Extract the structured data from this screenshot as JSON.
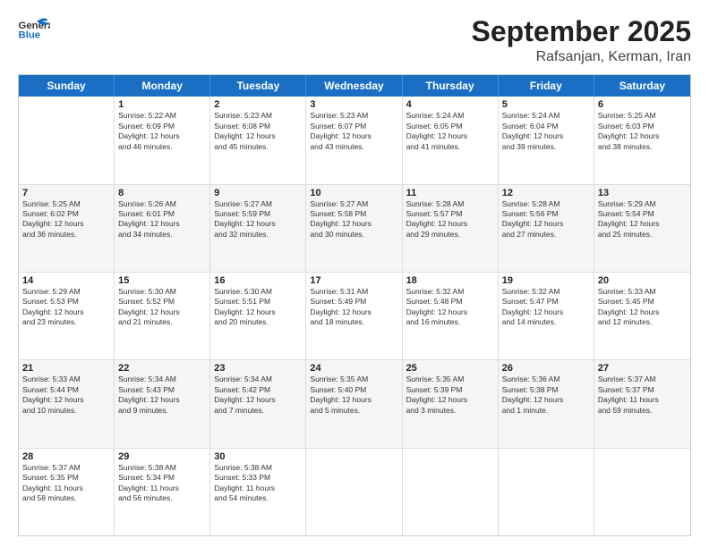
{
  "header": {
    "logo_line1": "General",
    "logo_line2": "Blue",
    "month": "September 2025",
    "location": "Rafsanjan, Kerman, Iran"
  },
  "days_of_week": [
    "Sunday",
    "Monday",
    "Tuesday",
    "Wednesday",
    "Thursday",
    "Friday",
    "Saturday"
  ],
  "rows": [
    [
      {
        "day": "",
        "lines": []
      },
      {
        "day": "1",
        "lines": [
          "Sunrise: 5:22 AM",
          "Sunset: 6:09 PM",
          "Daylight: 12 hours",
          "and 46 minutes."
        ]
      },
      {
        "day": "2",
        "lines": [
          "Sunrise: 5:23 AM",
          "Sunset: 6:08 PM",
          "Daylight: 12 hours",
          "and 45 minutes."
        ]
      },
      {
        "day": "3",
        "lines": [
          "Sunrise: 5:23 AM",
          "Sunset: 6:07 PM",
          "Daylight: 12 hours",
          "and 43 minutes."
        ]
      },
      {
        "day": "4",
        "lines": [
          "Sunrise: 5:24 AM",
          "Sunset: 6:05 PM",
          "Daylight: 12 hours",
          "and 41 minutes."
        ]
      },
      {
        "day": "5",
        "lines": [
          "Sunrise: 5:24 AM",
          "Sunset: 6:04 PM",
          "Daylight: 12 hours",
          "and 39 minutes."
        ]
      },
      {
        "day": "6",
        "lines": [
          "Sunrise: 5:25 AM",
          "Sunset: 6:03 PM",
          "Daylight: 12 hours",
          "and 38 minutes."
        ]
      }
    ],
    [
      {
        "day": "7",
        "lines": [
          "Sunrise: 5:25 AM",
          "Sunset: 6:02 PM",
          "Daylight: 12 hours",
          "and 36 minutes."
        ]
      },
      {
        "day": "8",
        "lines": [
          "Sunrise: 5:26 AM",
          "Sunset: 6:01 PM",
          "Daylight: 12 hours",
          "and 34 minutes."
        ]
      },
      {
        "day": "9",
        "lines": [
          "Sunrise: 5:27 AM",
          "Sunset: 5:59 PM",
          "Daylight: 12 hours",
          "and 32 minutes."
        ]
      },
      {
        "day": "10",
        "lines": [
          "Sunrise: 5:27 AM",
          "Sunset: 5:58 PM",
          "Daylight: 12 hours",
          "and 30 minutes."
        ]
      },
      {
        "day": "11",
        "lines": [
          "Sunrise: 5:28 AM",
          "Sunset: 5:57 PM",
          "Daylight: 12 hours",
          "and 29 minutes."
        ]
      },
      {
        "day": "12",
        "lines": [
          "Sunrise: 5:28 AM",
          "Sunset: 5:56 PM",
          "Daylight: 12 hours",
          "and 27 minutes."
        ]
      },
      {
        "day": "13",
        "lines": [
          "Sunrise: 5:29 AM",
          "Sunset: 5:54 PM",
          "Daylight: 12 hours",
          "and 25 minutes."
        ]
      }
    ],
    [
      {
        "day": "14",
        "lines": [
          "Sunrise: 5:29 AM",
          "Sunset: 5:53 PM",
          "Daylight: 12 hours",
          "and 23 minutes."
        ]
      },
      {
        "day": "15",
        "lines": [
          "Sunrise: 5:30 AM",
          "Sunset: 5:52 PM",
          "Daylight: 12 hours",
          "and 21 minutes."
        ]
      },
      {
        "day": "16",
        "lines": [
          "Sunrise: 5:30 AM",
          "Sunset: 5:51 PM",
          "Daylight: 12 hours",
          "and 20 minutes."
        ]
      },
      {
        "day": "17",
        "lines": [
          "Sunrise: 5:31 AM",
          "Sunset: 5:49 PM",
          "Daylight: 12 hours",
          "and 18 minutes."
        ]
      },
      {
        "day": "18",
        "lines": [
          "Sunrise: 5:32 AM",
          "Sunset: 5:48 PM",
          "Daylight: 12 hours",
          "and 16 minutes."
        ]
      },
      {
        "day": "19",
        "lines": [
          "Sunrise: 5:32 AM",
          "Sunset: 5:47 PM",
          "Daylight: 12 hours",
          "and 14 minutes."
        ]
      },
      {
        "day": "20",
        "lines": [
          "Sunrise: 5:33 AM",
          "Sunset: 5:45 PM",
          "Daylight: 12 hours",
          "and 12 minutes."
        ]
      }
    ],
    [
      {
        "day": "21",
        "lines": [
          "Sunrise: 5:33 AM",
          "Sunset: 5:44 PM",
          "Daylight: 12 hours",
          "and 10 minutes."
        ]
      },
      {
        "day": "22",
        "lines": [
          "Sunrise: 5:34 AM",
          "Sunset: 5:43 PM",
          "Daylight: 12 hours",
          "and 9 minutes."
        ]
      },
      {
        "day": "23",
        "lines": [
          "Sunrise: 5:34 AM",
          "Sunset: 5:42 PM",
          "Daylight: 12 hours",
          "and 7 minutes."
        ]
      },
      {
        "day": "24",
        "lines": [
          "Sunrise: 5:35 AM",
          "Sunset: 5:40 PM",
          "Daylight: 12 hours",
          "and 5 minutes."
        ]
      },
      {
        "day": "25",
        "lines": [
          "Sunrise: 5:35 AM",
          "Sunset: 5:39 PM",
          "Daylight: 12 hours",
          "and 3 minutes."
        ]
      },
      {
        "day": "26",
        "lines": [
          "Sunrise: 5:36 AM",
          "Sunset: 5:38 PM",
          "Daylight: 12 hours",
          "and 1 minute."
        ]
      },
      {
        "day": "27",
        "lines": [
          "Sunrise: 5:37 AM",
          "Sunset: 5:37 PM",
          "Daylight: 11 hours",
          "and 59 minutes."
        ]
      }
    ],
    [
      {
        "day": "28",
        "lines": [
          "Sunrise: 5:37 AM",
          "Sunset: 5:35 PM",
          "Daylight: 11 hours",
          "and 58 minutes."
        ]
      },
      {
        "day": "29",
        "lines": [
          "Sunrise: 5:38 AM",
          "Sunset: 5:34 PM",
          "Daylight: 11 hours",
          "and 56 minutes."
        ]
      },
      {
        "day": "30",
        "lines": [
          "Sunrise: 5:38 AM",
          "Sunset: 5:33 PM",
          "Daylight: 11 hours",
          "and 54 minutes."
        ]
      },
      {
        "day": "",
        "lines": []
      },
      {
        "day": "",
        "lines": []
      },
      {
        "day": "",
        "lines": []
      },
      {
        "day": "",
        "lines": []
      }
    ]
  ]
}
